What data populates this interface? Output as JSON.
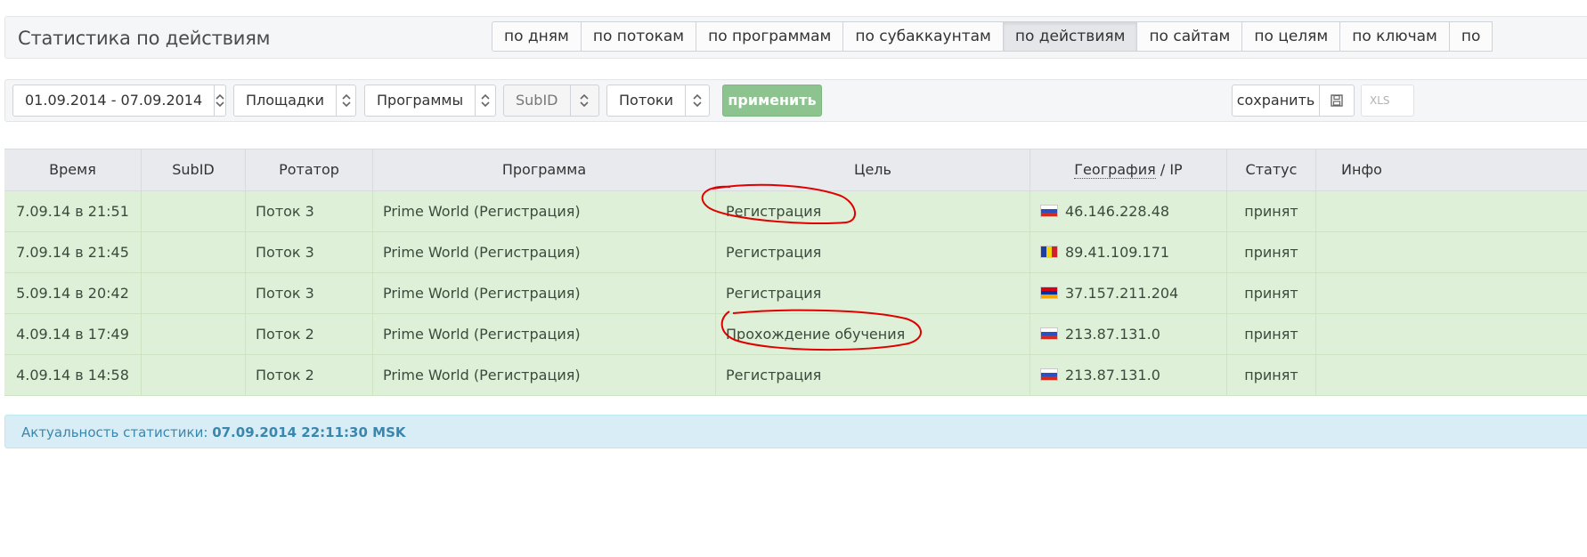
{
  "header": {
    "title": "Статистика по действиям",
    "tabs": [
      {
        "label": "по дням",
        "active": false
      },
      {
        "label": "по потокам",
        "active": false
      },
      {
        "label": "по программам",
        "active": false
      },
      {
        "label": "по субаккаунтам",
        "active": false
      },
      {
        "label": "по действиям",
        "active": true
      },
      {
        "label": "по сайтам",
        "active": false
      },
      {
        "label": "по целям",
        "active": false
      },
      {
        "label": "по ключам",
        "active": false
      },
      {
        "label": "по",
        "active": false
      }
    ]
  },
  "filters": {
    "date_range": "01.09.2014 - 07.09.2014",
    "sites": "Площадки",
    "programs": "Программы",
    "subid": "SubID",
    "streams": "Потоки",
    "apply_label": "применить",
    "save_label": "сохранить",
    "xls_label": "XLS"
  },
  "table": {
    "columns": {
      "time": "Время",
      "subid": "SubID",
      "rotator": "Ротатор",
      "program": "Программа",
      "goal": "Цель",
      "geo": "География",
      "geo_sep": "/ IP",
      "status": "Статус",
      "info": "Инфо"
    },
    "rows": [
      {
        "time": "7.09.14 в 21:51",
        "subid": "",
        "rotator": "Поток 3",
        "program": "Prime World (Регистрация)",
        "goal": "Регистрация",
        "flag": "ru",
        "ip": "46.146.228.48",
        "status": "принят",
        "info": ""
      },
      {
        "time": "7.09.14 в 21:45",
        "subid": "",
        "rotator": "Поток 3",
        "program": "Prime World (Регистрация)",
        "goal": "Регистрация",
        "flag": "md",
        "ip": "89.41.109.171",
        "status": "принят",
        "info": ""
      },
      {
        "time": "5.09.14 в 20:42",
        "subid": "",
        "rotator": "Поток 3",
        "program": "Prime World (Регистрация)",
        "goal": "Регистрация",
        "flag": "am",
        "ip": "37.157.211.204",
        "status": "принят",
        "info": ""
      },
      {
        "time": "4.09.14 в 17:49",
        "subid": "",
        "rotator": "Поток 2",
        "program": "Prime World (Регистрация)",
        "goal": "Прохождение обучения",
        "flag": "ru",
        "ip": "213.87.131.0",
        "status": "принят",
        "info": ""
      },
      {
        "time": "4.09.14 в 14:58",
        "subid": "",
        "rotator": "Поток 2",
        "program": "Prime World (Регистрация)",
        "goal": "Регистрация",
        "flag": "ru",
        "ip": "213.87.131.0",
        "status": "принят",
        "info": ""
      }
    ]
  },
  "footer": {
    "label": "Актуальность статистики:",
    "value": "07.09.2014 22:11:30 MSK"
  },
  "colors": {
    "row_bg": "#dff0d8",
    "apply_bg": "#8cc38f",
    "footer_bg": "#d9edf7",
    "annotation": "#e00000"
  }
}
